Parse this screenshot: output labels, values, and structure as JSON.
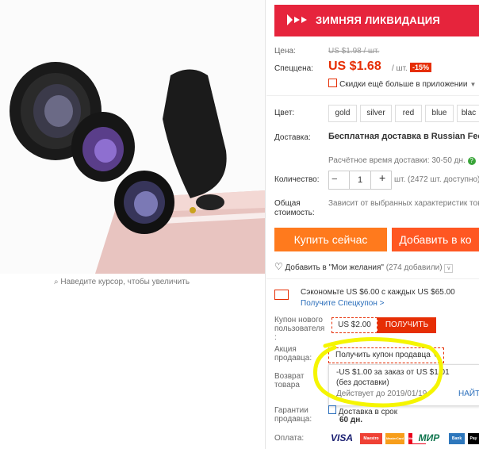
{
  "left": {
    "zoom_hint": "Наведите курсор, чтобы увеличить"
  },
  "banner": {
    "text": "ЗИМНЯЯ ЛИКВИДАЦИЯ"
  },
  "price": {
    "label": "Цена:",
    "old": "US $1.98 / шт.",
    "special_label": "Спеццена:",
    "value": "US $1.68",
    "per": "/ шт.",
    "discount": "-15%",
    "app_discount": "Скидки ещё больше в приложении"
  },
  "color": {
    "label": "Цвет:",
    "options": [
      "gold",
      "silver",
      "red",
      "blue",
      "blac"
    ]
  },
  "delivery": {
    "label": "Доставка:",
    "value": "Бесплатная доставка в Russian Federatio",
    "time": "Расчётное время доставки: 30-50 дн."
  },
  "quantity": {
    "label": "Количество:",
    "value": "1",
    "minus": "−",
    "plus": "+",
    "stock": "шт. (2472 шт. доступно)"
  },
  "total": {
    "label": "Общая стоимость:",
    "value": "Зависит от выбранных характеристик това"
  },
  "actions": {
    "buy": "Купить сейчас",
    "cart": "Добавить в ко"
  },
  "wishlist": {
    "text": "Добавить в \"Мои желания\"",
    "count": "(274 добавили)"
  },
  "promo": {
    "save_text": "Сэкономьте US $6.00 с каждых US $65.00",
    "save_link": "Получите Спецкупон >",
    "new_user_label": "Купон нового пользователя :",
    "new_user_amount": "US $2.00",
    "new_user_button": "ПОЛУЧИТЬ",
    "seller_label": "Акция продавца:",
    "seller_dropdown": "Получить купон продавца",
    "coupon_line1": "-US $1.00 за заказ от US $1.01",
    "coupon_line2": "(без доставки)",
    "coupon_valid": "Действует до 2019/01/19",
    "coupon_find": "НАЙТ",
    "return_label": "Возврат товара",
    "guarantee_label": "Гарантии продавца:",
    "guarantee_value": "Доставка в срок",
    "guarantee_days": "60 дн.",
    "payment_label": "Оплата:"
  },
  "payments": [
    "VISA",
    "Maestro",
    "MasterCard",
    "Mastercard",
    "МИР",
    "Bank",
    "Pay"
  ],
  "colors": {
    "accent": "#e62e04",
    "banner": "#e6243c",
    "buy": "#ff7a1d",
    "cart": "#ff5722",
    "highlight": "#f5f500"
  }
}
